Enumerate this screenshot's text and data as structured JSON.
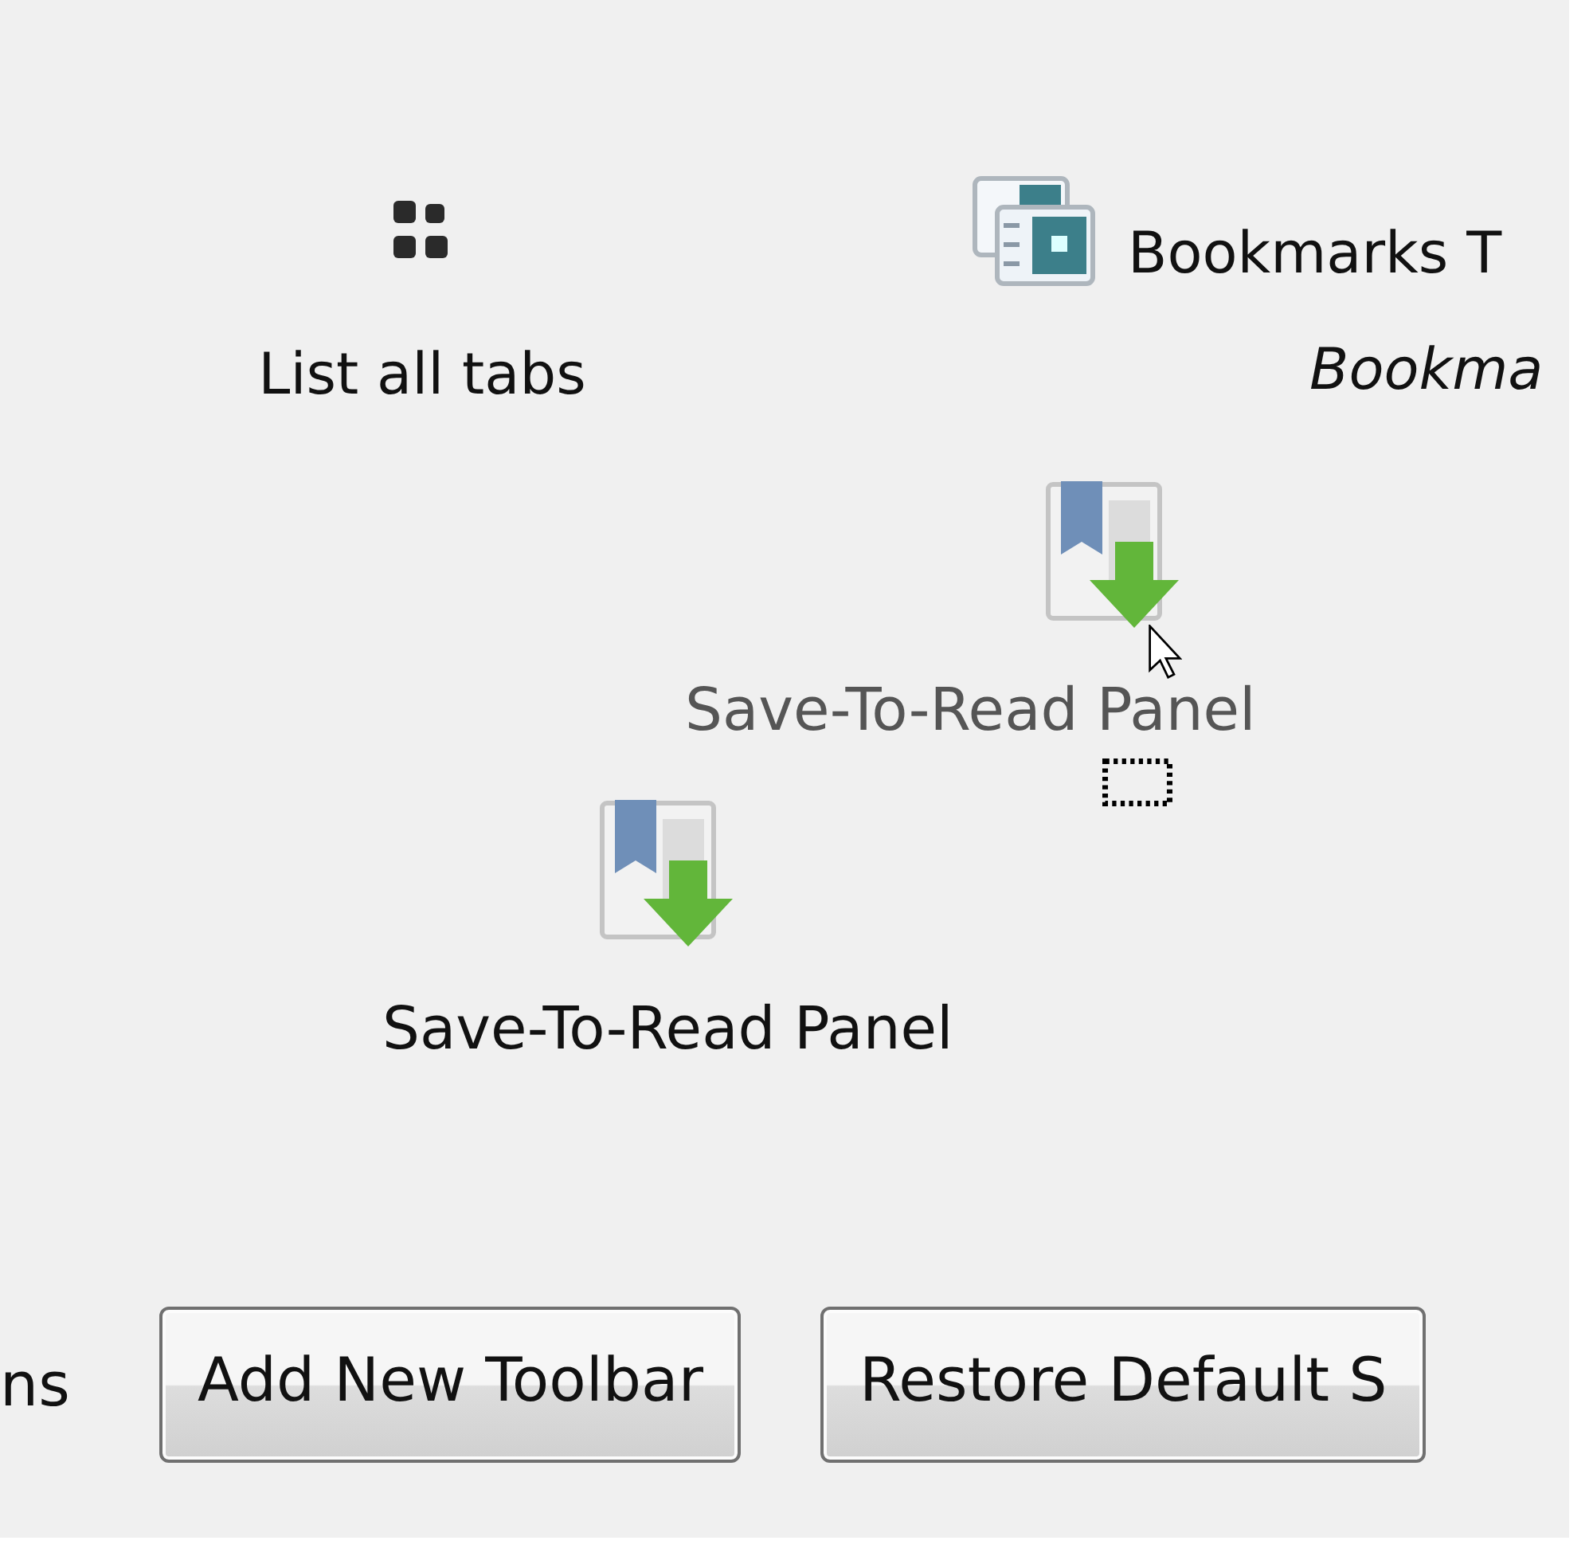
{
  "palette": {
    "items": [
      {
        "kind": "list-tabs",
        "label": "List all tabs"
      },
      {
        "kind": "bookmarks",
        "label": "Bookmarks T",
        "sublabel": "Bookma"
      },
      {
        "kind": "save-to-read",
        "label": "Save-To-Read Panel",
        "dragging": true
      },
      {
        "kind": "save-to-read",
        "label": "Save-To-Read Panel",
        "dragging": false
      }
    ]
  },
  "footer": {
    "show_label": "ns",
    "buttons": [
      "Add New Toolbar",
      "Restore Default S"
    ]
  }
}
